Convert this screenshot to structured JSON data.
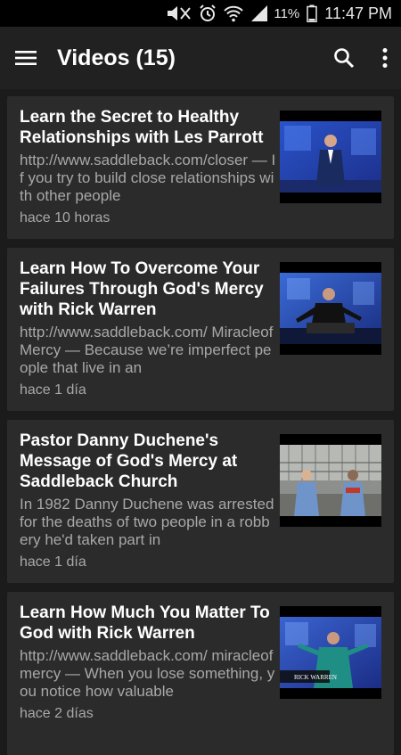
{
  "status_bar": {
    "battery_percent": "11%",
    "time": "11:47 PM",
    "icons": [
      "mute-icon",
      "alarm-icon",
      "wifi-icon",
      "signal-icon",
      "battery-icon"
    ]
  },
  "app_bar": {
    "title": "Videos (15)",
    "icons": [
      "menu-icon",
      "search-icon",
      "more-vert-icon"
    ]
  },
  "videos": [
    {
      "title": "Learn the Secret to Healthy Relationships with Les Parrott",
      "description": "http://www.saddleback.com/closer — If you try to build close relationships with other people",
      "time": "hace 10 horas"
    },
    {
      "title": "Learn How To Overcome Your Failures Through God's Mercy with Rick Warren",
      "description": "http://www.saddleback.com/ MiracleofMercy — Because we’re imperfect people that live in an",
      "time": "hace 1 día"
    },
    {
      "title": "Pastor Danny Duchene's Message of God's Mercy at Saddleback Church",
      "description": "In 1982 Danny Duchene was arrested for the deaths of two people in a robbery he'd taken part in",
      "time": "hace 1 día"
    },
    {
      "title": "Learn How Much You Matter To God with Rick Warren",
      "description": "http://www.saddleback.com/ miracleofmercy — When you lose something, you notice how valuable",
      "time": "hace 2 días",
      "thumbnail_caption": "RICK WARREN"
    }
  ]
}
